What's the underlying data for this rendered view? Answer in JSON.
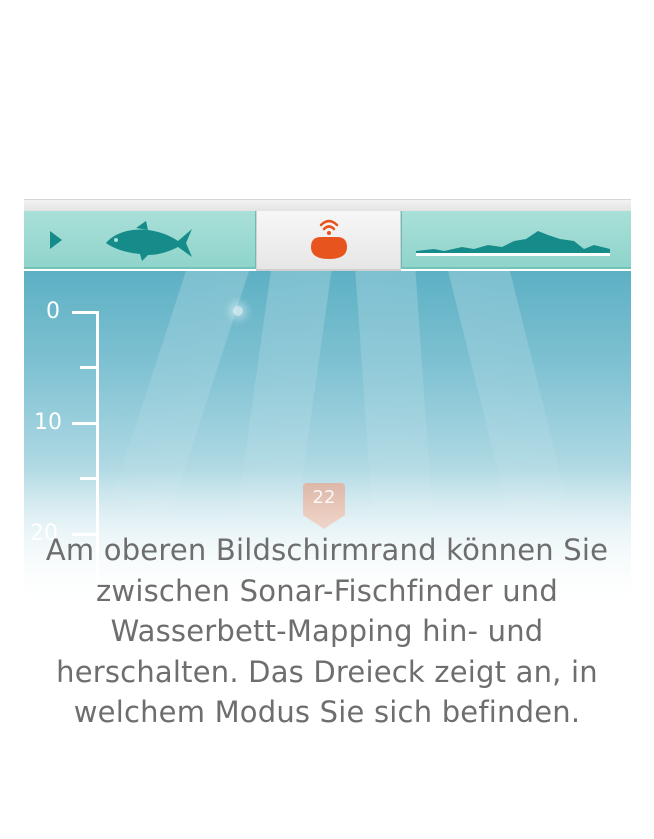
{
  "tabs": {
    "sonar": {
      "icon_play": "play-icon",
      "icon_fish": "fish-icon",
      "color": "#168c8a"
    },
    "device": {
      "icon": "sonar-device-icon",
      "color": "#e8541d",
      "active": true
    },
    "mapping": {
      "icon": "terrain-icon",
      "color": "#168c8a"
    }
  },
  "depth_scale": {
    "labels": [
      "0",
      "10",
      "20"
    ]
  },
  "depth_marker": {
    "value": "22",
    "color": "#f08a64"
  },
  "caption": {
    "text": "Am oberen Bildschirmrand können Sie zwischen Sonar-Fischfinder und Wasserbett-Mapping hin- und herschalten. Das Dreieck zeigt an, in welchem Modus Sie sich befinden."
  }
}
